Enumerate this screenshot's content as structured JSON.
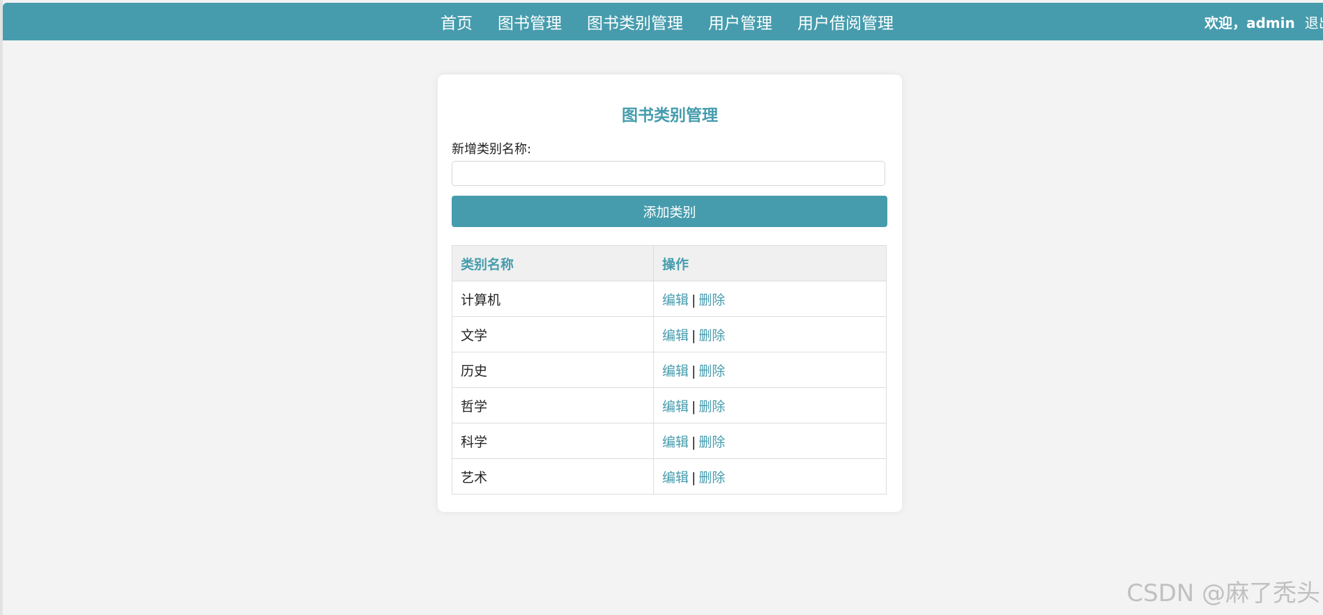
{
  "navbar": {
    "links": [
      "首页",
      "图书管理",
      "图书类别管理",
      "用户管理",
      "用户借阅管理"
    ],
    "welcome": "欢迎，admin",
    "logout": "退出"
  },
  "card": {
    "title": "图书类别管理",
    "form_label": "新增类别名称:",
    "input_value": "",
    "add_button": "添加类别"
  },
  "table": {
    "headers": [
      "类别名称",
      "操作"
    ],
    "rows": [
      {
        "name": "计算机",
        "edit": "编辑",
        "separator": "|",
        "delete": "删除"
      },
      {
        "name": "文学",
        "edit": "编辑",
        "separator": "|",
        "delete": "删除"
      },
      {
        "name": "历史",
        "edit": "编辑",
        "separator": "|",
        "delete": "删除"
      },
      {
        "name": "哲学",
        "edit": "编辑",
        "separator": "|",
        "delete": "删除"
      },
      {
        "name": "科学",
        "edit": "编辑",
        "separator": "|",
        "delete": "删除"
      },
      {
        "name": "艺术",
        "edit": "编辑",
        "separator": "|",
        "delete": "删除"
      }
    ]
  },
  "watermark": "CSDN @麻了秃头",
  "colors": {
    "accent": "#469cad",
    "background": "#f3f3f3",
    "header_row": "#f0f0f0"
  }
}
